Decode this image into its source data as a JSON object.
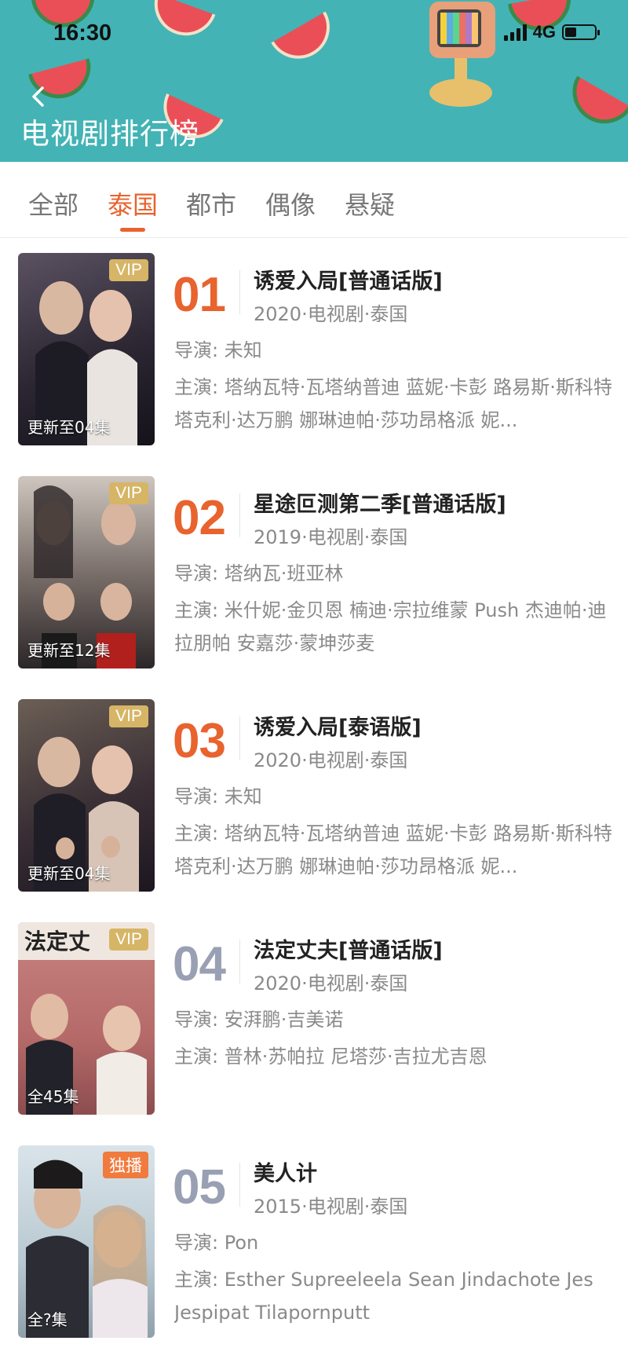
{
  "status": {
    "time": "16:30",
    "network": "4G"
  },
  "header": {
    "title": "电视剧排行榜"
  },
  "tabs": [
    {
      "label": "全部",
      "active": false
    },
    {
      "label": "泰国",
      "active": true
    },
    {
      "label": "都市",
      "active": false
    },
    {
      "label": "偶像",
      "active": false
    },
    {
      "label": "悬疑",
      "active": false
    }
  ],
  "colors": {
    "accent": "#e8632e",
    "header_bg": "#43b3b5",
    "vip": "#d6b566",
    "exclusive": "#f07b3e",
    "rank_gray": "#9aa0b3"
  },
  "items": [
    {
      "rank": "01",
      "title": "诱爱入局[普通话版]",
      "meta": "2020·电视剧·泰国",
      "director": "导演: 未知",
      "cast": "主演: 塔纳瓦特·瓦塔纳普迪 蓝妮·卡彭 路易斯·斯科特 塔克利·达万鹏 娜琳迪帕·莎功昂格派 妮...",
      "badge": "VIP",
      "update": "更新至04集"
    },
    {
      "rank": "02",
      "title": "星途叵测第二季[普通话版]",
      "meta": "2019·电视剧·泰国",
      "director": "导演: 塔纳瓦·班亚林",
      "cast": "主演: 米什妮·金贝恩 楠迪·宗拉维蒙 Push 杰迪帕·迪拉朋帕 安嘉莎·蒙坤莎麦",
      "badge": "VIP",
      "update": "更新至12集"
    },
    {
      "rank": "03",
      "title": "诱爱入局[泰语版]",
      "meta": "2020·电视剧·泰国",
      "director": "导演: 未知",
      "cast": "主演: 塔纳瓦特·瓦塔纳普迪 蓝妮·卡彭 路易斯·斯科特 塔克利·达万鹏 娜琳迪帕·莎功昂格派 妮...",
      "badge": "VIP",
      "update": "更新至04集"
    },
    {
      "rank": "04",
      "title": "法定丈夫[普通话版]",
      "meta": "2020·电视剧·泰国",
      "director": "导演: 安湃鹏·吉美诺",
      "cast": "主演: 普林·苏帕拉 尼塔莎·吉拉尤吉恩",
      "badge": "VIP",
      "update": "全45集"
    },
    {
      "rank": "05",
      "title": "美人计",
      "meta": "2015·电视剧·泰国",
      "director": "导演: Pon",
      "cast": "主演: Esther Supreeleela Sean Jindachote Jes Jespipat Tilapornputt",
      "badge": "独播",
      "update": "全?集"
    }
  ]
}
